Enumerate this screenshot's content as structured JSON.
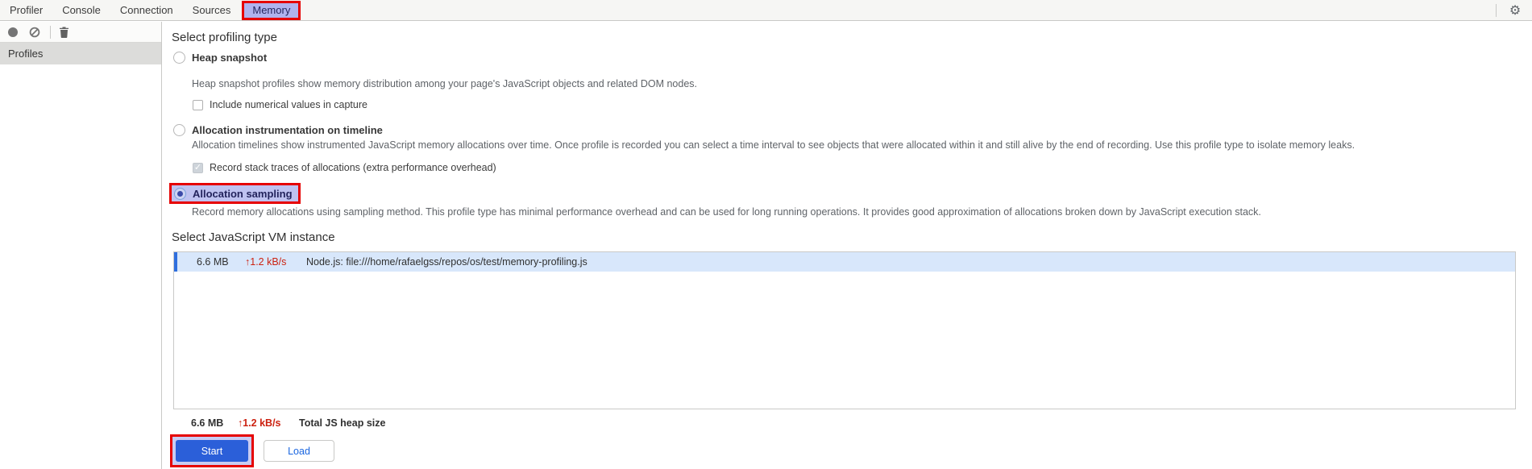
{
  "tabs": {
    "items": [
      {
        "label": "Profiler"
      },
      {
        "label": "Console"
      },
      {
        "label": "Connection"
      },
      {
        "label": "Sources"
      },
      {
        "label": "Memory"
      }
    ],
    "selected": "Memory"
  },
  "toolbar": {
    "icons": [
      "record-icon",
      "block-icon",
      "delete-icon"
    ],
    "gear_icon": "⚙"
  },
  "sidebar": {
    "profiles_label": "Profiles"
  },
  "profiling": {
    "heading": "Select profiling type",
    "options": [
      {
        "label": "Heap snapshot",
        "description": "Heap snapshot profiles show memory distribution among your page's JavaScript objects and related DOM nodes.",
        "selected": false,
        "checkbox": {
          "label": "Include numerical values in capture",
          "checked": false
        }
      },
      {
        "label": "Allocation instrumentation on timeline",
        "description": "Allocation timelines show instrumented JavaScript memory allocations over time. Once profile is recorded you can select a time interval to see objects that were allocated within it and still alive by the end of recording. Use this profile type to isolate memory leaks.",
        "selected": false,
        "checkbox": {
          "label": "Record stack traces of allocations (extra performance overhead)",
          "checked": true,
          "disabled": true,
          "checkmark": "✓"
        }
      },
      {
        "label": "Allocation sampling",
        "description": "Record memory allocations using sampling method. This profile type has minimal performance overhead and can be used for long running operations. It provides good approximation of allocations broken down by JavaScript execution stack.",
        "selected": true,
        "highlighted": true
      }
    ]
  },
  "vm": {
    "heading": "Select JavaScript VM instance",
    "instances": [
      {
        "size": "6.6 MB",
        "rate": "↑1.2 kB/s",
        "title": "Node.js: file:///home/rafaelgss/repos/os/test/memory-profiling.js",
        "selected": true
      }
    ],
    "total": {
      "size": "6.6 MB",
      "rate": "↑1.2 kB/s",
      "label": "Total JS heap size"
    }
  },
  "actions": {
    "start_label": "Start",
    "load_label": "Load"
  },
  "colors": {
    "annotation_red": "#e60000",
    "selected_tab_bg": "#b0b3ee",
    "sampling_highlight_bg": "#bfc2f0",
    "start_button_bg": "#2b5fd9",
    "load_button_text": "#1a66e0",
    "vm_row_bg": "#d8e7fb",
    "vm_row_accent": "#2f6fde",
    "rate_text_red": "#cc2211"
  }
}
